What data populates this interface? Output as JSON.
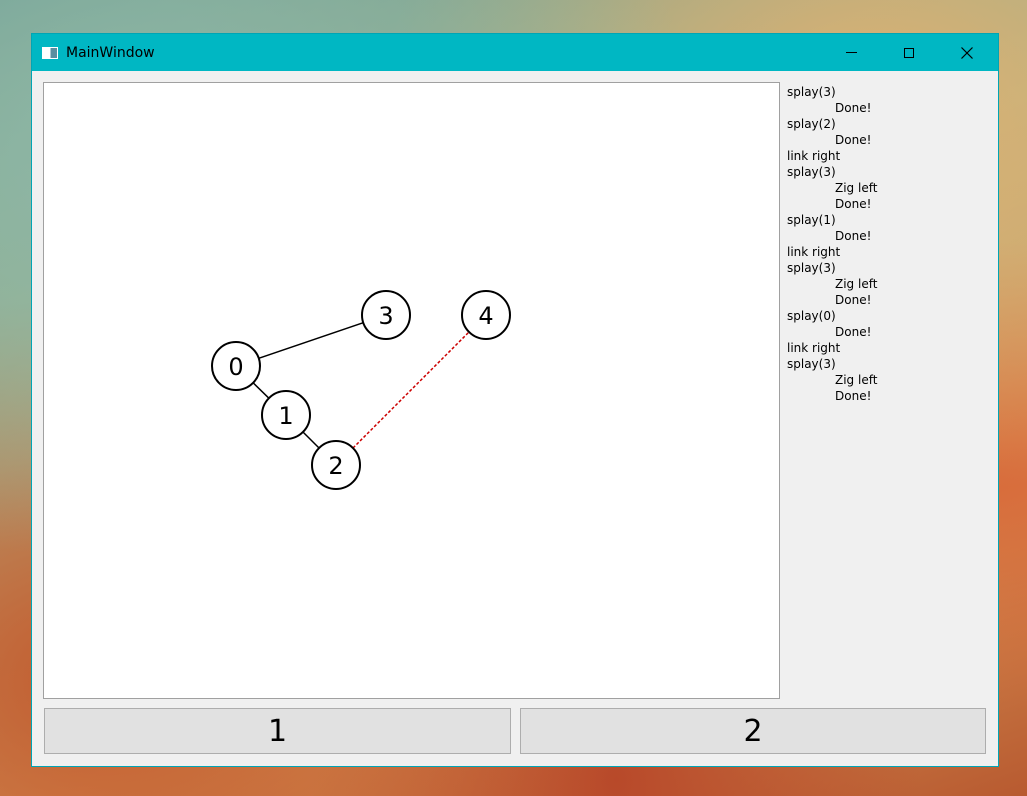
{
  "window": {
    "title": "MainWindow"
  },
  "tree": {
    "nodes": [
      {
        "id": "0",
        "label": "0"
      },
      {
        "id": "1",
        "label": "1"
      },
      {
        "id": "2",
        "label": "2"
      },
      {
        "id": "3",
        "label": "3"
      },
      {
        "id": "4",
        "label": "4"
      }
    ],
    "edges": [
      {
        "from": "0",
        "to": "3",
        "style": "solid",
        "color": "#000000"
      },
      {
        "from": "0",
        "to": "1",
        "style": "solid",
        "color": "#000000"
      },
      {
        "from": "1",
        "to": "2",
        "style": "solid",
        "color": "#000000"
      },
      {
        "from": "2",
        "to": "4",
        "style": "dashed",
        "color": "#cc0000"
      }
    ]
  },
  "log": [
    {
      "text": "splay(3)",
      "indent": false
    },
    {
      "text": "Done!",
      "indent": true
    },
    {
      "text": "splay(2)",
      "indent": false
    },
    {
      "text": "Done!",
      "indent": true
    },
    {
      "text": "link right",
      "indent": false
    },
    {
      "text": "splay(3)",
      "indent": false
    },
    {
      "text": "Zig left",
      "indent": true
    },
    {
      "text": "Done!",
      "indent": true
    },
    {
      "text": "splay(1)",
      "indent": false
    },
    {
      "text": "Done!",
      "indent": true
    },
    {
      "text": "link right",
      "indent": false
    },
    {
      "text": "splay(3)",
      "indent": false
    },
    {
      "text": "Zig left",
      "indent": true
    },
    {
      "text": "Done!",
      "indent": true
    },
    {
      "text": "splay(0)",
      "indent": false
    },
    {
      "text": "Done!",
      "indent": true
    },
    {
      "text": "link right",
      "indent": false
    },
    {
      "text": "splay(3)",
      "indent": false
    },
    {
      "text": "Zig left",
      "indent": true
    },
    {
      "text": "Done!",
      "indent": true
    }
  ],
  "buttons": {
    "one": "1",
    "two": "2"
  }
}
